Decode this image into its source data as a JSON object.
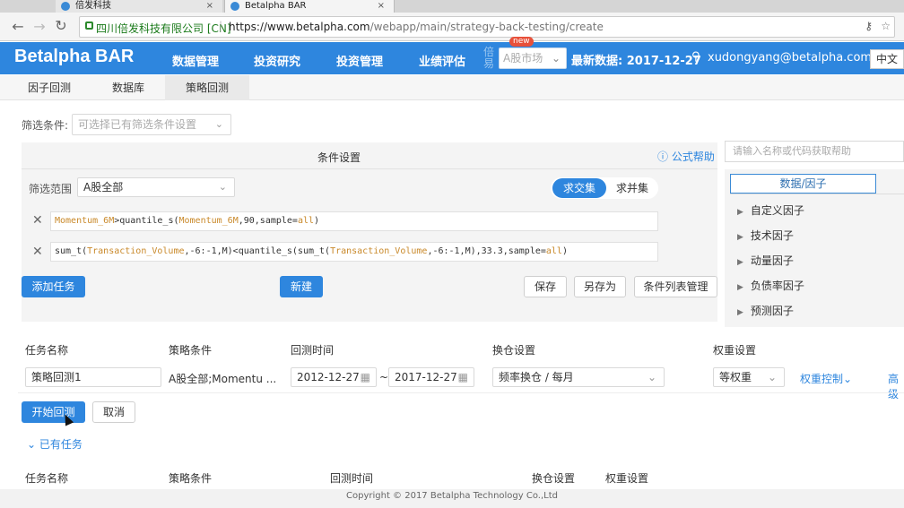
{
  "browser": {
    "tabs": [
      {
        "title": "倍发科技"
      },
      {
        "title": "Betalpha BAR"
      }
    ],
    "site_label": "四川倍发科技有限公司 [CN]",
    "url_prefix": "https://www.betalpha.com",
    "url_path": "/webapp/main/strategy-back-testing/create"
  },
  "header": {
    "logo": "Betalpha BAR",
    "nav": [
      "数据管理",
      "投资研究",
      "投资管理",
      "业绩评估"
    ],
    "ghost_text": "倍易",
    "new_badge": "new",
    "market_select": "A股市场",
    "latest_data": "最新数据: 2017-12-27",
    "user_email": "xudongyang@betalpha.com",
    "language": "中文"
  },
  "subtabs": [
    "因子回测",
    "数据库",
    "策略回测"
  ],
  "filter": {
    "label": "筛选条件:",
    "placeholder": "可选择已有筛选条件设置"
  },
  "conditions": {
    "title": "条件设置",
    "formula_help": "公式帮助",
    "range_label": "筛选范围",
    "range_value": "A股全部",
    "intersect": "求交集",
    "union": "求并集",
    "expr1": {
      "k1": "Momentum_6M",
      "t1": ">quantile_s(",
      "k2": "Momentum_6M",
      "t2": ",90,sample=",
      "k3": "all",
      "t3": ")"
    },
    "expr2": {
      "t0": "sum_t(",
      "k1": "Transaction_Volume",
      "t1": ",-6:-1,M)<quantile_s(sum_t(",
      "k2": "Transaction_Volume",
      "t2": ",-6:-1,M),33.3,sample=",
      "k3": "all",
      "t3": ")"
    },
    "add_task": "添加任务",
    "new": "新建",
    "save": "保存",
    "save_as": "另存为",
    "manage": "条件列表管理"
  },
  "right_panel": {
    "search_placeholder": "请输入名称或代码获取帮助",
    "tab": "数据/因子",
    "items": [
      "自定义因子",
      "技术因子",
      "动量因子",
      "负债率因子",
      "预测因子"
    ]
  },
  "task": {
    "headers": [
      "任务名称",
      "策略条件",
      "回测时间",
      "换仓设置",
      "权重设置"
    ],
    "name_value": "策略回测1",
    "strategy_value": "A股全部;Momentu ...",
    "start_date": "2012-12-27",
    "tilde": "~",
    "end_date": "2017-12-27",
    "rebalance": "频率换仓 / 每月",
    "weight": "等权重",
    "weight_control": "权重控制",
    "advanced": "高级",
    "start_button": "开始回测",
    "cancel_button": "取消",
    "existing_tasks": "已有任务",
    "headers2": [
      "任务名称",
      "策略条件",
      "回测时间",
      "换仓设置",
      "权重设置"
    ]
  },
  "footer": "Copyright © 2017 Betalpha Technology Co.,Ltd"
}
